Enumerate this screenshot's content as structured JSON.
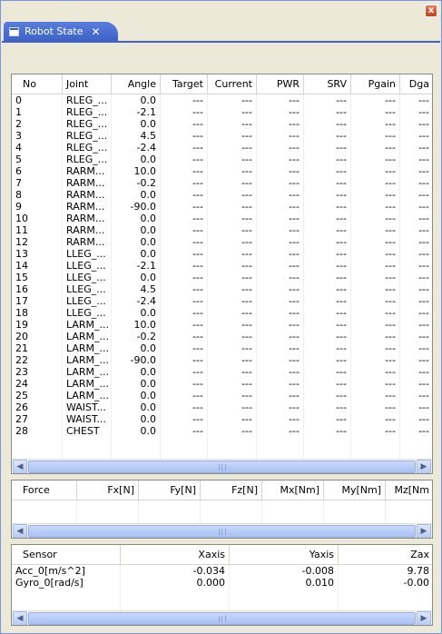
{
  "window": {
    "close_label": "x"
  },
  "tab": {
    "title": "Robot State",
    "close_label": "✕"
  },
  "joint_table": {
    "columns": [
      "No",
      "Joint",
      "Angle",
      "Target",
      "Current",
      "PWR",
      "SRV",
      "Pgain",
      "Dga"
    ],
    "rows": [
      [
        "0",
        "RLEG_...",
        "0.0",
        "---",
        "---",
        "---",
        "---",
        "---",
        "---"
      ],
      [
        "1",
        "RLEG_...",
        "-2.1",
        "---",
        "---",
        "---",
        "---",
        "---",
        "---"
      ],
      [
        "2",
        "RLEG_...",
        "0.0",
        "---",
        "---",
        "---",
        "---",
        "---",
        "---"
      ],
      [
        "3",
        "RLEG_...",
        "4.5",
        "---",
        "---",
        "---",
        "---",
        "---",
        "---"
      ],
      [
        "4",
        "RLEG_...",
        "-2.4",
        "---",
        "---",
        "---",
        "---",
        "---",
        "---"
      ],
      [
        "5",
        "RLEG_...",
        "0.0",
        "---",
        "---",
        "---",
        "---",
        "---",
        "---"
      ],
      [
        "6",
        "RARM...",
        "10.0",
        "---",
        "---",
        "---",
        "---",
        "---",
        "---"
      ],
      [
        "7",
        "RARM...",
        "-0.2",
        "---",
        "---",
        "---",
        "---",
        "---",
        "---"
      ],
      [
        "8",
        "RARM...",
        "0.0",
        "---",
        "---",
        "---",
        "---",
        "---",
        "---"
      ],
      [
        "9",
        "RARM...",
        "-90.0",
        "---",
        "---",
        "---",
        "---",
        "---",
        "---"
      ],
      [
        "10",
        "RARM...",
        "0.0",
        "---",
        "---",
        "---",
        "---",
        "---",
        "---"
      ],
      [
        "11",
        "RARM...",
        "0.0",
        "---",
        "---",
        "---",
        "---",
        "---",
        "---"
      ],
      [
        "12",
        "RARM...",
        "0.0",
        "---",
        "---",
        "---",
        "---",
        "---",
        "---"
      ],
      [
        "13",
        "LLEG_...",
        "0.0",
        "---",
        "---",
        "---",
        "---",
        "---",
        "---"
      ],
      [
        "14",
        "LLEG_...",
        "-2.1",
        "---",
        "---",
        "---",
        "---",
        "---",
        "---"
      ],
      [
        "15",
        "LLEG_...",
        "0.0",
        "---",
        "---",
        "---",
        "---",
        "---",
        "---"
      ],
      [
        "16",
        "LLEG_...",
        "4.5",
        "---",
        "---",
        "---",
        "---",
        "---",
        "---"
      ],
      [
        "17",
        "LLEG_...",
        "-2.4",
        "---",
        "---",
        "---",
        "---",
        "---",
        "---"
      ],
      [
        "18",
        "LLEG_...",
        "0.0",
        "---",
        "---",
        "---",
        "---",
        "---",
        "---"
      ],
      [
        "19",
        "LARM_...",
        "10.0",
        "---",
        "---",
        "---",
        "---",
        "---",
        "---"
      ],
      [
        "20",
        "LARM_...",
        "-0.2",
        "---",
        "---",
        "---",
        "---",
        "---",
        "---"
      ],
      [
        "21",
        "LARM_...",
        "0.0",
        "---",
        "---",
        "---",
        "---",
        "---",
        "---"
      ],
      [
        "22",
        "LARM_...",
        "-90.0",
        "---",
        "---",
        "---",
        "---",
        "---",
        "---"
      ],
      [
        "23",
        "LARM_...",
        "0.0",
        "---",
        "---",
        "---",
        "---",
        "---",
        "---"
      ],
      [
        "24",
        "LARM_...",
        "0.0",
        "---",
        "---",
        "---",
        "---",
        "---",
        "---"
      ],
      [
        "25",
        "LARM_...",
        "0.0",
        "---",
        "---",
        "---",
        "---",
        "---",
        "---"
      ],
      [
        "26",
        "WAIST...",
        "0.0",
        "---",
        "---",
        "---",
        "---",
        "---",
        "---"
      ],
      [
        "27",
        "WAIST...",
        "0.0",
        "---",
        "---",
        "---",
        "---",
        "---",
        "---"
      ],
      [
        "28",
        "CHEST",
        "0.0",
        "---",
        "---",
        "---",
        "---",
        "---",
        "---"
      ]
    ],
    "scroll_grip": "III"
  },
  "force_table": {
    "columns": [
      "Force",
      "Fx[N]",
      "Fy[N]",
      "Fz[N]",
      "Mx[Nm]",
      "My[Nm]",
      "Mz[Nm"
    ],
    "rows": [],
    "scroll_grip": "III"
  },
  "sensor_table": {
    "columns": [
      "Sensor",
      "Xaxis",
      "Yaxis",
      "Zax"
    ],
    "rows": [
      [
        "Acc_0[m/s^2]",
        "-0.034",
        "-0.008",
        "9.78"
      ],
      [
        "Gyro_0[rad/s]",
        "0.000",
        "0.010",
        "-0.00"
      ]
    ],
    "scroll_grip": "III"
  }
}
